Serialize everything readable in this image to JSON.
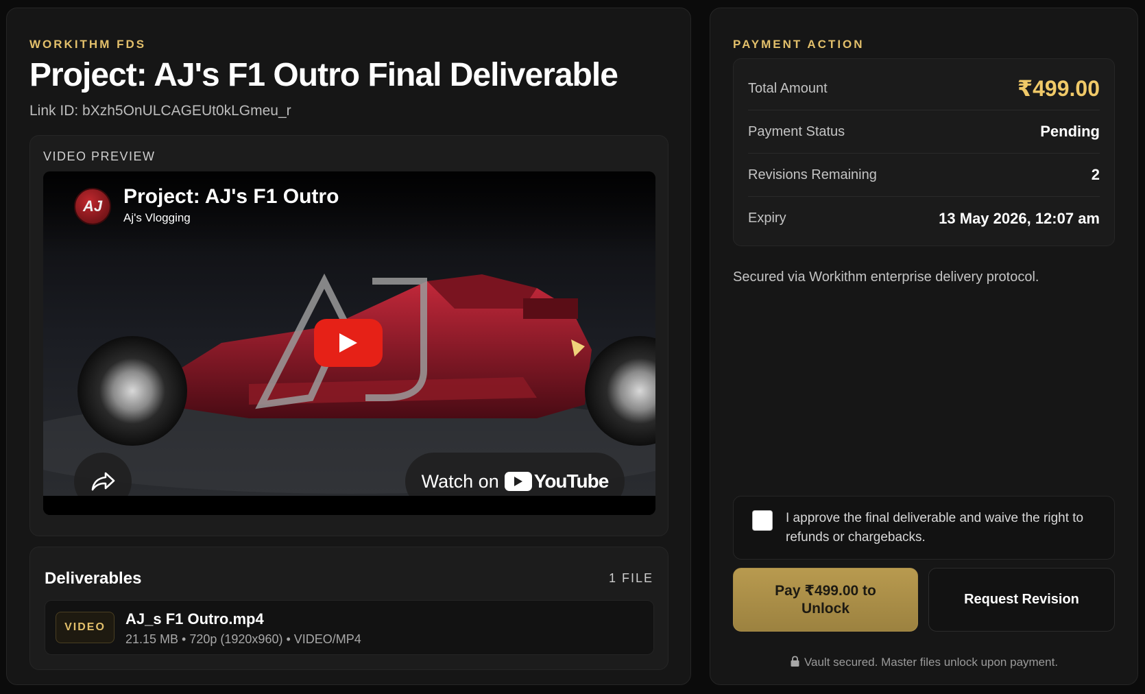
{
  "left": {
    "eyebrow": "WORKITHM FDS",
    "title": "Project: AJ's F1 Outro Final Deliverable",
    "link_id": "Link ID: bXzh5OnULCAGEUt0kLGmeu_r",
    "preview": {
      "label": "VIDEO PREVIEW",
      "video_title": "Project: AJ's F1 Outro",
      "channel": "Aj's Vlogging",
      "avatar_text": "AJ",
      "watch_on": "Watch on",
      "youtube_word": "YouTube"
    },
    "deliverables": {
      "title": "Deliverables",
      "count": "1 FILE",
      "files": [
        {
          "badge": "VIDEO",
          "name": "AJ_s F1 Outro.mp4",
          "meta": "21.15 MB • 720p (1920x960) • VIDEO/MP4"
        }
      ]
    }
  },
  "right": {
    "eyebrow": "PAYMENT ACTION",
    "summary": [
      {
        "key": "Total Amount",
        "value": "₹499.00"
      },
      {
        "key": "Payment Status",
        "value": "Pending"
      },
      {
        "key": "Revisions Remaining",
        "value": "2"
      },
      {
        "key": "Expiry",
        "value": "13 May 2026, 12:07 am"
      }
    ],
    "secured_note": "Secured via Workithm enterprise delivery protocol.",
    "approve_text": "I approve the final deliverable and waive the right to refunds or chargebacks.",
    "approve_checked": false,
    "pay_label": "Pay ₹499.00 to Unlock",
    "revision_label": "Request Revision",
    "vault_note": "Vault secured. Master files unlock upon payment."
  },
  "colors": {
    "accent_gold": "#e3c06b",
    "amount_gold": "#f0c968",
    "pay_button": "#b89a4f",
    "youtube_red": "#e62117"
  }
}
